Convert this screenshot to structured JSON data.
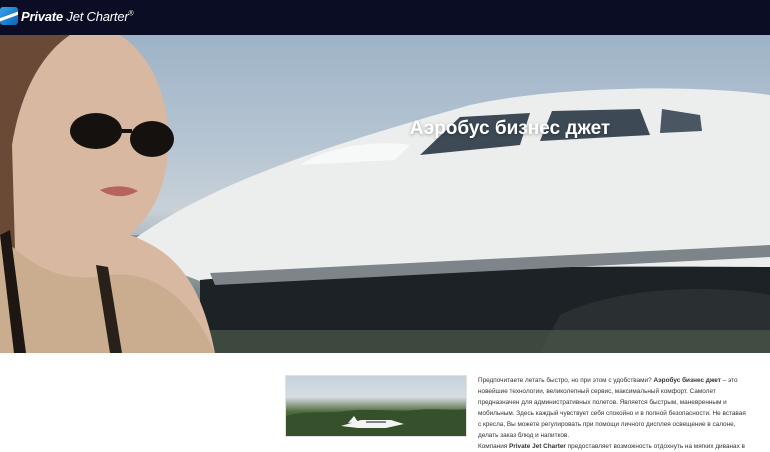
{
  "header": {
    "logo_brand": "Private",
    "logo_word": "Jet Charter",
    "logo_mark": "®"
  },
  "hero": {
    "title": "Аэробус бизнес джет"
  },
  "article": {
    "p1_before": "Предпочитаете летать быстро, но при этом с удобствами?",
    "p1_strong": "Аэробус бизнес джет",
    "p1_after": " – это новейшие технологии, великолепный сервис, максимальный комфорт. Самолет предназначен для административных полетов. Является быстрым, маневренным и мобильным. Здесь каждый чувствует себя спокойно и в полной безопасности. Не вставая с кресла, Вы можете регулировать при помощи личного дисплея освещение в салоне, делать заказ блюд и напитков.",
    "p2_before": "Компания ",
    "p2_strong": "Private Jet Charter",
    "p2_after": " предоставляет возможность отдохнуть на мягких диванах в"
  },
  "colors": {
    "header_bg": "#0a0d24",
    "logo_accent": "#3aa3ea"
  },
  "icons": {
    "logo": "airplane-swoosh-icon"
  }
}
